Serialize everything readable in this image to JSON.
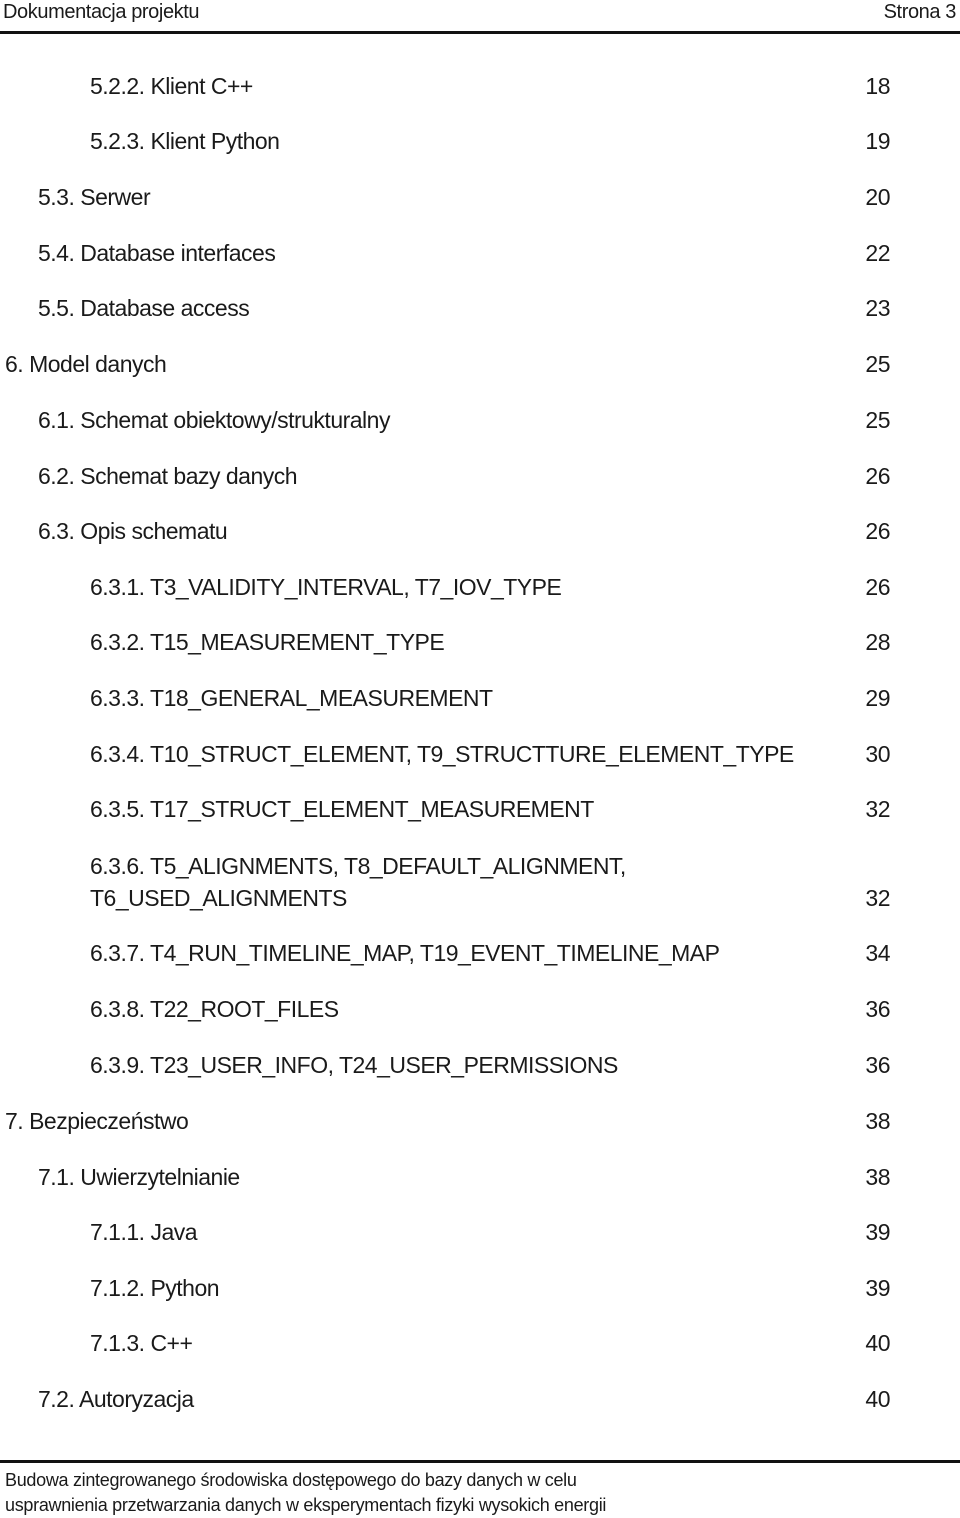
{
  "header": {
    "title": "Dokumentacja projektu",
    "page": "Strona 3"
  },
  "toc": [
    {
      "number": "5.2.2.",
      "title": "Klient C++",
      "page": "18"
    },
    {
      "number": "5.2.3.",
      "title": "Klient Python",
      "page": "19"
    },
    {
      "number": "5.3.",
      "title": "Serwer",
      "page": "20"
    },
    {
      "number": "5.4.",
      "title": "Database interfaces",
      "page": "22"
    },
    {
      "number": "5.5.",
      "title": "Database access",
      "page": "23"
    },
    {
      "number": "6.",
      "title": "Model danych",
      "page": "25"
    },
    {
      "number": "6.1.",
      "title": "Schemat obiektowy/strukturalny",
      "page": "25"
    },
    {
      "number": "6.2.",
      "title": "Schemat bazy danych",
      "page": "26"
    },
    {
      "number": "6.3.",
      "title": "Opis schematu",
      "page": "26"
    },
    {
      "number": "6.3.1.",
      "title": "T3_VALIDITY_INTERVAL, T7_IOV_TYPE",
      "page": "26"
    },
    {
      "number": "6.3.2.",
      "title": "T15_MEASUREMENT_TYPE",
      "page": "28"
    },
    {
      "number": "6.3.3.",
      "title": "T18_GENERAL_MEASUREMENT",
      "page": "29"
    },
    {
      "number": "6.3.4.",
      "title": "T10_STRUCT_ELEMENT, T9_STRUCTTURE_ELEMENT_TYPE",
      "page": "30"
    },
    {
      "number": "6.3.5.",
      "title": "T17_STRUCT_ELEMENT_MEASUREMENT",
      "page": "32"
    },
    {
      "number": "6.3.6.",
      "title": "T5_ALIGNMENTS, T8_DEFAULT_ALIGNMENT,",
      "title2": "T6_USED_ALIGNMENTS",
      "page": "32"
    },
    {
      "number": "6.3.7.",
      "title": "T4_RUN_TIMELINE_MAP, T19_EVENT_TIMELINE_MAP",
      "page": "34"
    },
    {
      "number": "6.3.8.",
      "title": "T22_ROOT_FILES",
      "page": "36"
    },
    {
      "number": "6.3.9.",
      "title": "T23_USER_INFO, T24_USER_PERMISSIONS",
      "page": "36"
    },
    {
      "number": "7.",
      "title": "Bezpieczeństwo",
      "page": "38"
    },
    {
      "number": "7.1.",
      "title": "Uwierzytelnianie",
      "page": "38"
    },
    {
      "number": "7.1.1.",
      "title": "Java",
      "page": "39"
    },
    {
      "number": "7.1.2.",
      "title": "Python",
      "page": "39"
    },
    {
      "number": "7.1.3.",
      "title": "C++",
      "page": "40"
    },
    {
      "number": "7.2.",
      "title": "Autoryzacja",
      "page": "40"
    }
  ],
  "footer": {
    "line1": "Budowa zintegrowanego środowiska dostępowego do bazy danych w celu",
    "line2": "usprawnienia przetwarzania danych w eksperymentach fizyki wysokich energii"
  }
}
